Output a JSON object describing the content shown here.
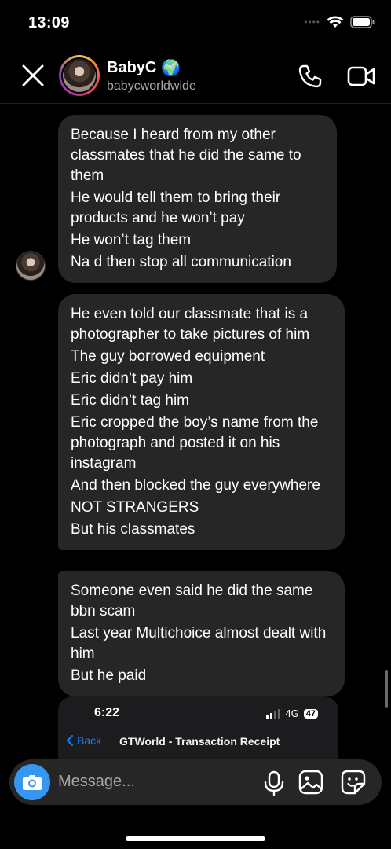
{
  "status_bar": {
    "time": "13:09"
  },
  "header": {
    "contact_name": "BabyC",
    "contact_emoji": "🌍",
    "contact_handle": "babycworldwide"
  },
  "messages": [
    {
      "lines": [
        "Because I heard from my other classmates that he did the same to them",
        "He would tell them to bring their products and he won’t pay",
        "He won’t tag them",
        "Na d then stop all communication"
      ]
    },
    {
      "lines": [
        "He even told our classmate that is a photographer to take pictures of him",
        "The guy borrowed equipment",
        "Eric didn’t pay him",
        "Eric didn’t tag him",
        "Eric cropped the boy’s name from the photograph and posted it on his instagram",
        "And then blocked the guy everywhere",
        "NOT STRANGERS",
        "But his classmates"
      ]
    },
    {
      "lines": [
        "Someone even said he did the same bbn scam",
        "Last year Multichoice almost dealt with him",
        "But he paid"
      ]
    }
  ],
  "attachment": {
    "time": "6:22",
    "network": "4G",
    "battery": "47",
    "back_label": "Back",
    "title": "GTWorld - Transaction Receipt"
  },
  "composer": {
    "placeholder": "Message..."
  },
  "colors": {
    "bubble": "#262626",
    "accent": "#3797f0",
    "background": "#000000"
  }
}
